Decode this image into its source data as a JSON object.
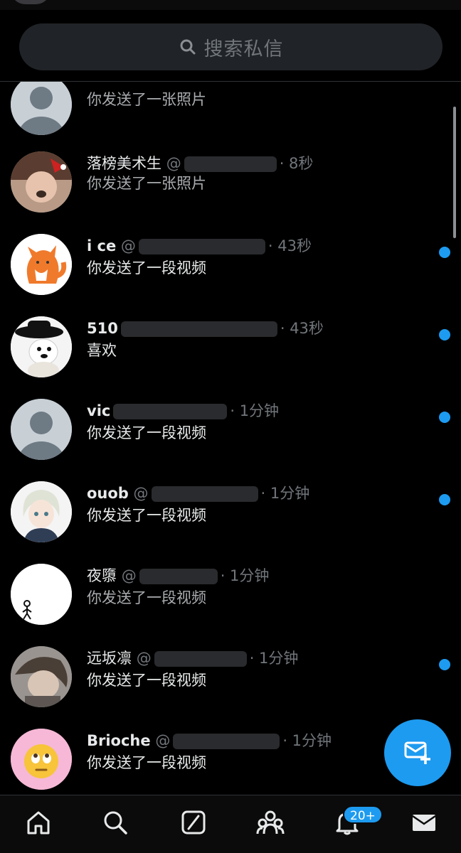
{
  "search": {
    "placeholder": "搜索私信",
    "icon": "search-icon"
  },
  "conversations": [
    {
      "name": "",
      "handle": "@",
      "time": "",
      "preview": "你发送了一张照片",
      "unread": false
    },
    {
      "name": "落榜美术生",
      "handle": "@",
      "time": "· 8秒",
      "preview": "你发送了一张照片",
      "unread": false
    },
    {
      "name": "i ce",
      "handle": "@",
      "time": "· 43秒",
      "preview": "你发送了一段视频",
      "unread": true
    },
    {
      "name": "510",
      "handle": "",
      "time": "· 43秒",
      "preview": "喜欢",
      "unread": true
    },
    {
      "name": "vic",
      "handle": "",
      "time": "· 1分钟",
      "preview": "你发送了一段视频",
      "unread": true
    },
    {
      "name": "ouob",
      "handle": "@",
      "time": "· 1分钟",
      "preview": "你发送了一段视频",
      "unread": true
    },
    {
      "name": "夜隳",
      "handle": "@",
      "time": "· 1分钟",
      "preview": "你发送了一段视频",
      "unread": false
    },
    {
      "name": "远坂凛",
      "handle": "@",
      "time": "· 1分钟",
      "preview": "你发送了一段视频",
      "unread": true
    },
    {
      "name": "Brioche",
      "handle": "@",
      "time": "· 1分钟",
      "preview": "你发送了一段视频",
      "unread": true
    }
  ],
  "fab": {
    "icon": "new-message-icon"
  },
  "bottom_nav": {
    "items": [
      "home-icon",
      "search-icon",
      "grok-icon",
      "communities-icon",
      "notifications-icon",
      "messages-icon"
    ],
    "notification_badge": "20+"
  },
  "colors": {
    "accent": "#1d9bf0",
    "background": "#000000",
    "secondary_text": "#71767b"
  }
}
